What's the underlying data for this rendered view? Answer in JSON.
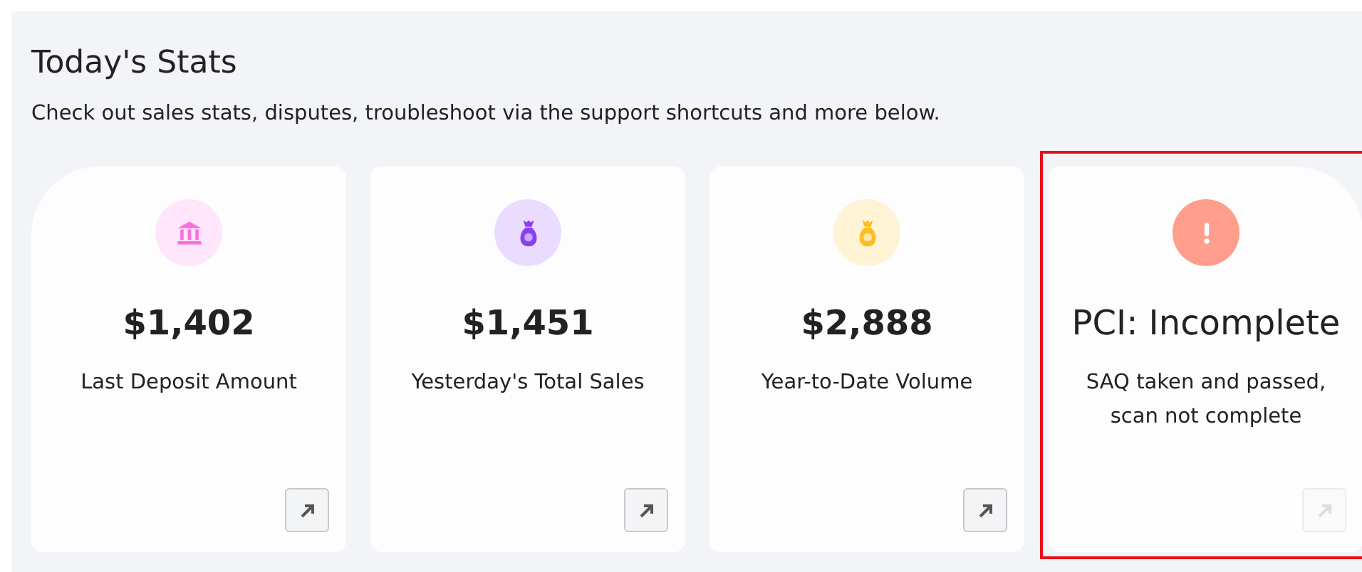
{
  "title": "Today's Stats",
  "subtitle": "Check out sales stats, disputes, troubleshoot via the support shortcuts and more below.",
  "cards": [
    {
      "kind": "bank",
      "value": "$1,402",
      "label": "Last Deposit Amount",
      "highlighted": false,
      "link_disabled": false
    },
    {
      "kind": "sales",
      "value": "$1,451",
      "label": "Yesterday's Total Sales",
      "highlighted": false,
      "link_disabled": false
    },
    {
      "kind": "volume",
      "value": "$2,888",
      "label": "Year-to-Date Volume",
      "highlighted": false,
      "link_disabled": false
    },
    {
      "kind": "alert",
      "value": "PCI: Incomplete",
      "label": "SAQ taken and passed, scan not complete",
      "highlighted": true,
      "link_disabled": true
    }
  ]
}
